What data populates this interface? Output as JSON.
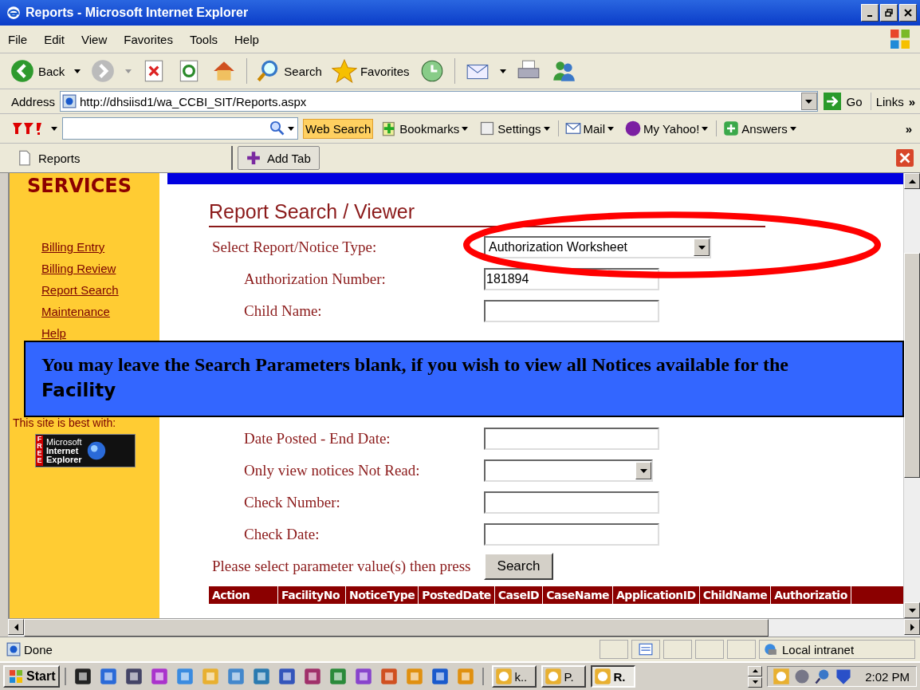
{
  "window": {
    "title": "Reports - Microsoft Internet Explorer"
  },
  "menu": [
    "File",
    "Edit",
    "View",
    "Favorites",
    "Tools",
    "Help"
  ],
  "toolbar": [
    {
      "kind": "back",
      "label": "Back"
    },
    {
      "kind": "forward"
    },
    {
      "kind": "stop"
    },
    {
      "kind": "refresh"
    },
    {
      "kind": "home"
    },
    {
      "kind": "search",
      "label": "Search"
    },
    {
      "kind": "favorites",
      "label": "Favorites"
    },
    {
      "kind": "history"
    },
    {
      "kind": "mail"
    },
    {
      "kind": "print"
    },
    {
      "kind": "messenger"
    }
  ],
  "address": {
    "label": "Address",
    "url": "http://dhsiisd1/wa_CCBI_SIT/Reports.aspx",
    "go": "Go",
    "links": "Links",
    "more": "»"
  },
  "yahoo": {
    "search_button": "Web Search",
    "items": [
      {
        "kind": "bookmarks",
        "label": "Bookmarks"
      },
      {
        "kind": "settings",
        "label": "Settings"
      },
      {
        "kind": "mail",
        "label": "Mail"
      },
      {
        "kind": "myyahoo",
        "label": "My Yahoo!"
      },
      {
        "kind": "answers",
        "label": "Answers"
      }
    ],
    "more": "»"
  },
  "tabs": [
    {
      "label": "Reports",
      "selected": true
    },
    {
      "label": "Add Tab",
      "selected": false
    }
  ],
  "sidebar": {
    "heading": "SERVICES",
    "items": [
      "Billing Entry",
      "Billing Review",
      "Report Search",
      "Maintenance",
      "Help"
    ],
    "best_with": "This site is best with:",
    "badge": {
      "free": "FREE",
      "line1": "Microsoft",
      "line2": "Internet",
      "line3": "Explorer"
    }
  },
  "page": {
    "heading": "Report Search / Viewer",
    "fields": [
      {
        "kind": "select",
        "label": "Select Report/Notice Type:",
        "value": "Authorization Worksheet"
      },
      {
        "kind": "text",
        "label": "Authorization Number:",
        "value": "181894"
      },
      {
        "kind": "text",
        "label": "Child Name:"
      },
      {
        "kind": "hidden"
      },
      {
        "kind": "text",
        "label": "Date Posted - End Date:"
      },
      {
        "kind": "select",
        "label": "Only view notices Not Read:"
      },
      {
        "kind": "text",
        "label": "Check Number:"
      },
      {
        "kind": "text",
        "label": "Check Date:"
      }
    ],
    "prompt": "Please select parameter value(s) then press",
    "search_button": "Search",
    "table": {
      "columns": [
        "Action",
        "FacilityNo",
        "NoticeType",
        "PostedDate",
        "CaseID",
        "CaseName",
        "ApplicationID",
        "ChildName",
        "Authorizatio"
      ]
    }
  },
  "callout": {
    "text": "You may leave the Search Parameters blank, if you wish to view all Notices available for the",
    "last_word": "Facility"
  },
  "status_bar": {
    "text": "Done",
    "zone": "Local intranet"
  },
  "taskbar": {
    "start": "Start",
    "tasks": [
      {
        "label": "k..",
        "selected": false
      },
      {
        "label": "P.",
        "selected": false
      },
      {
        "label": "R.",
        "selected": true
      }
    ],
    "clock": "2:02 PM"
  }
}
